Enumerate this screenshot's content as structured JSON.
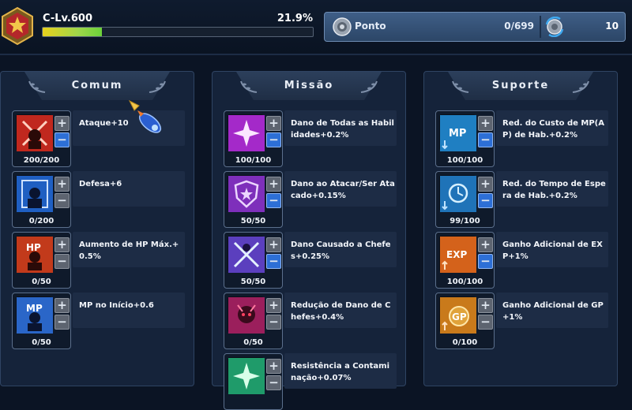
{
  "header": {
    "level_label": "C-Lv.600",
    "level_percent": "21.9%",
    "xp_progress": 0.219,
    "point_label": "Ponto",
    "point_value": "0/699",
    "reset_count": "10"
  },
  "panels": [
    {
      "title": "Comum",
      "skills": [
        {
          "desc": "Ataque+10",
          "count": "200/200",
          "icon": "attack-icon",
          "minus_active": true,
          "color": "#c0281e"
        },
        {
          "desc": "Defesa+6",
          "count": "0/200",
          "icon": "defense-icon",
          "minus_active": false,
          "color": "#1f5fc2"
        },
        {
          "desc": "Aumento de HP Máx.+0.5%",
          "count": "0/50",
          "icon": "hp-icon",
          "minus_active": false,
          "color": "#c23a1b"
        },
        {
          "desc": "MP no Início+0.6",
          "count": "0/50",
          "icon": "mp-icon",
          "minus_active": false,
          "color": "#2a66c8"
        }
      ]
    },
    {
      "title": "Missão",
      "skills": [
        {
          "desc": "Dano de Todas as Habilidades+0.2%",
          "count": "100/100",
          "icon": "all-skill-damage-icon",
          "minus_active": true,
          "color": "#a429c9"
        },
        {
          "desc": "Dano ao Atacar/Ser Atacado+0.15%",
          "count": "50/50",
          "icon": "shield-icon",
          "minus_active": true,
          "color": "#7e2fbb"
        },
        {
          "desc": "Dano Causado a Chefes+0.25%",
          "count": "50/50",
          "icon": "boss-damage-icon",
          "minus_active": true,
          "color": "#5b3fbe"
        },
        {
          "desc": "Redução de Dano de Chefes+0.4%",
          "count": "0/50",
          "icon": "boss-defense-icon",
          "minus_active": false,
          "color": "#9b1f5c"
        },
        {
          "desc": "Resistência a Contaminação+0.07%",
          "count": "",
          "icon": "contamination-icon",
          "minus_active": false,
          "color": "#1f9b6a"
        }
      ]
    },
    {
      "title": "Suporte",
      "skills": [
        {
          "desc": "Red. do Custo de MP(AP) de Hab.+0.2%",
          "count": "100/100",
          "icon": "mp-cost-icon",
          "minus_active": true,
          "color": "#1f7fc2"
        },
        {
          "desc": "Red. do Tempo de Espera de Hab.+0.2%",
          "count": "99/100",
          "icon": "cooldown-icon",
          "minus_active": true,
          "color": "#1f73b8"
        },
        {
          "desc": "Ganho Adicional de EXP+1%",
          "count": "100/100",
          "icon": "exp-icon",
          "minus_active": true,
          "color": "#d4621b"
        },
        {
          "desc": "Ganho Adicional de GP+1%",
          "count": "0/100",
          "icon": "gp-icon",
          "minus_active": false,
          "color": "#c97a1b"
        }
      ]
    }
  ]
}
